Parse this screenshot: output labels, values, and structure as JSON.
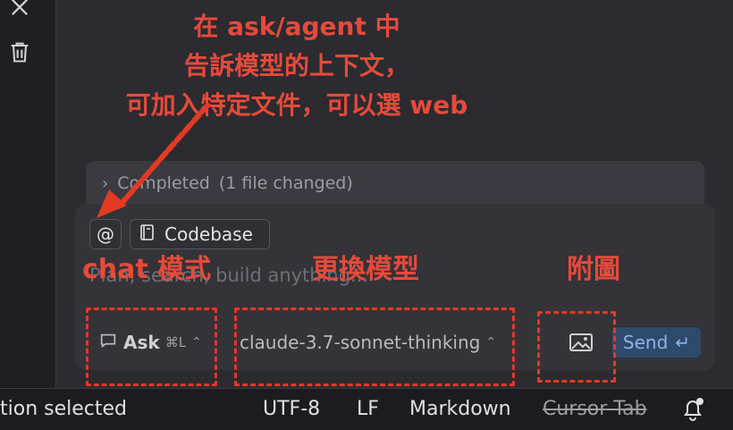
{
  "annotations": {
    "top_line1": "在 ask/agent 中",
    "top_line2": "告訴模型的上下文，",
    "top_line3": "可加入特定文件，可以選 web",
    "chat_mode": "chat 模式",
    "change_model": "更換模型",
    "attach_image": "附圖",
    "color": "#e64a3a"
  },
  "completed": {
    "status": "Completed",
    "detail": "(1 file changed)"
  },
  "composer": {
    "at_symbol": "@",
    "codebase_label": "Codebase",
    "placeholder": "Plan, search, build anything...",
    "mode_label": "Ask",
    "mode_shortcut": "⌘L",
    "model_name": "claude-3.7-sonnet-thinking",
    "send_label": "Send",
    "send_glyph": "↵",
    "accent": "#8db4e6"
  },
  "statusbar": {
    "selection": "tion selected",
    "encoding": "UTF-8",
    "line_ending": "LF",
    "language": "Markdown",
    "cursor_tab": "Cursor Tab"
  },
  "icons": [
    "close-icon",
    "trash-icon",
    "codebase-icon",
    "chat-bubble-icon",
    "image-icon",
    "bell-icon"
  ]
}
